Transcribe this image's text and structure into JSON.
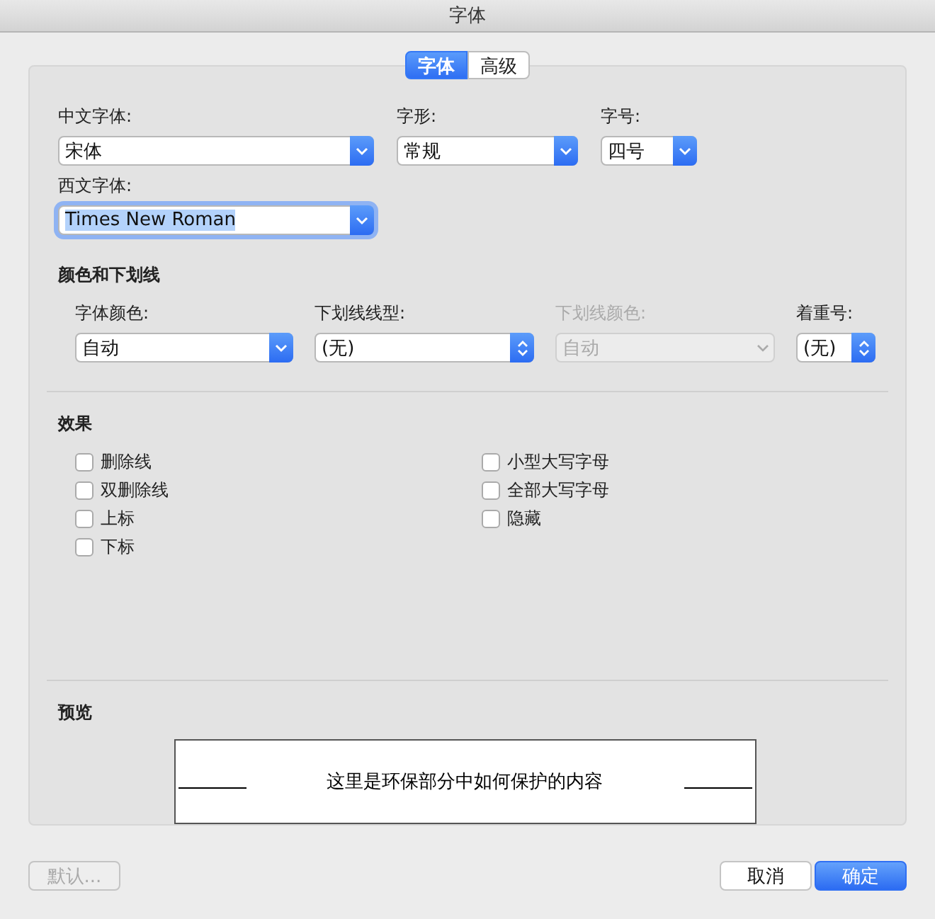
{
  "window": {
    "title": "字体"
  },
  "tabs": [
    {
      "label": "字体",
      "selected": true
    },
    {
      "label": "高级",
      "selected": false
    }
  ],
  "font_rows": [
    [
      {
        "label": "中文字体:",
        "value": "宋体",
        "kind": "popup",
        "focused": false,
        "disabled": false
      },
      {
        "label": "字形:",
        "value": "常规",
        "kind": "popup",
        "focused": false,
        "disabled": false
      },
      {
        "label": "字号:",
        "value": "四号",
        "kind": "popup",
        "focused": false,
        "disabled": false
      }
    ],
    [
      {
        "label": "西文字体:",
        "value": "Times New Roman",
        "kind": "popup",
        "focused": true,
        "disabled": false
      }
    ]
  ],
  "color_section": {
    "title": "颜色和下划线",
    "fields": [
      {
        "label": "字体颜色:",
        "value": "自动",
        "kind": "popup",
        "focused": false,
        "disabled": false
      },
      {
        "label": "下划线线型:",
        "value": "(无)",
        "kind": "stepper",
        "focused": false,
        "disabled": false
      },
      {
        "label": "下划线颜色:",
        "value": "自动",
        "kind": "popup",
        "focused": false,
        "disabled": true
      },
      {
        "label": "着重号:",
        "value": "(无)",
        "kind": "stepper",
        "focused": false,
        "disabled": false
      }
    ]
  },
  "effects": {
    "title": "效果",
    "left": [
      {
        "label": "删除线",
        "checked": false
      },
      {
        "label": "双删除线",
        "checked": false
      },
      {
        "label": "上标",
        "checked": false
      },
      {
        "label": "下标",
        "checked": false
      }
    ],
    "right": [
      {
        "label": "小型大写字母",
        "checked": false
      },
      {
        "label": "全部大写字母",
        "checked": false
      },
      {
        "label": "隐藏",
        "checked": false
      }
    ]
  },
  "preview": {
    "title": "预览",
    "text": "这里是环保部分中如何保护的内容"
  },
  "buttons": [
    {
      "label": "默认...",
      "disabled": true,
      "primary": false
    },
    {
      "label": "取消",
      "disabled": false,
      "primary": false
    },
    {
      "label": "确定",
      "disabled": false,
      "primary": true
    }
  ]
}
